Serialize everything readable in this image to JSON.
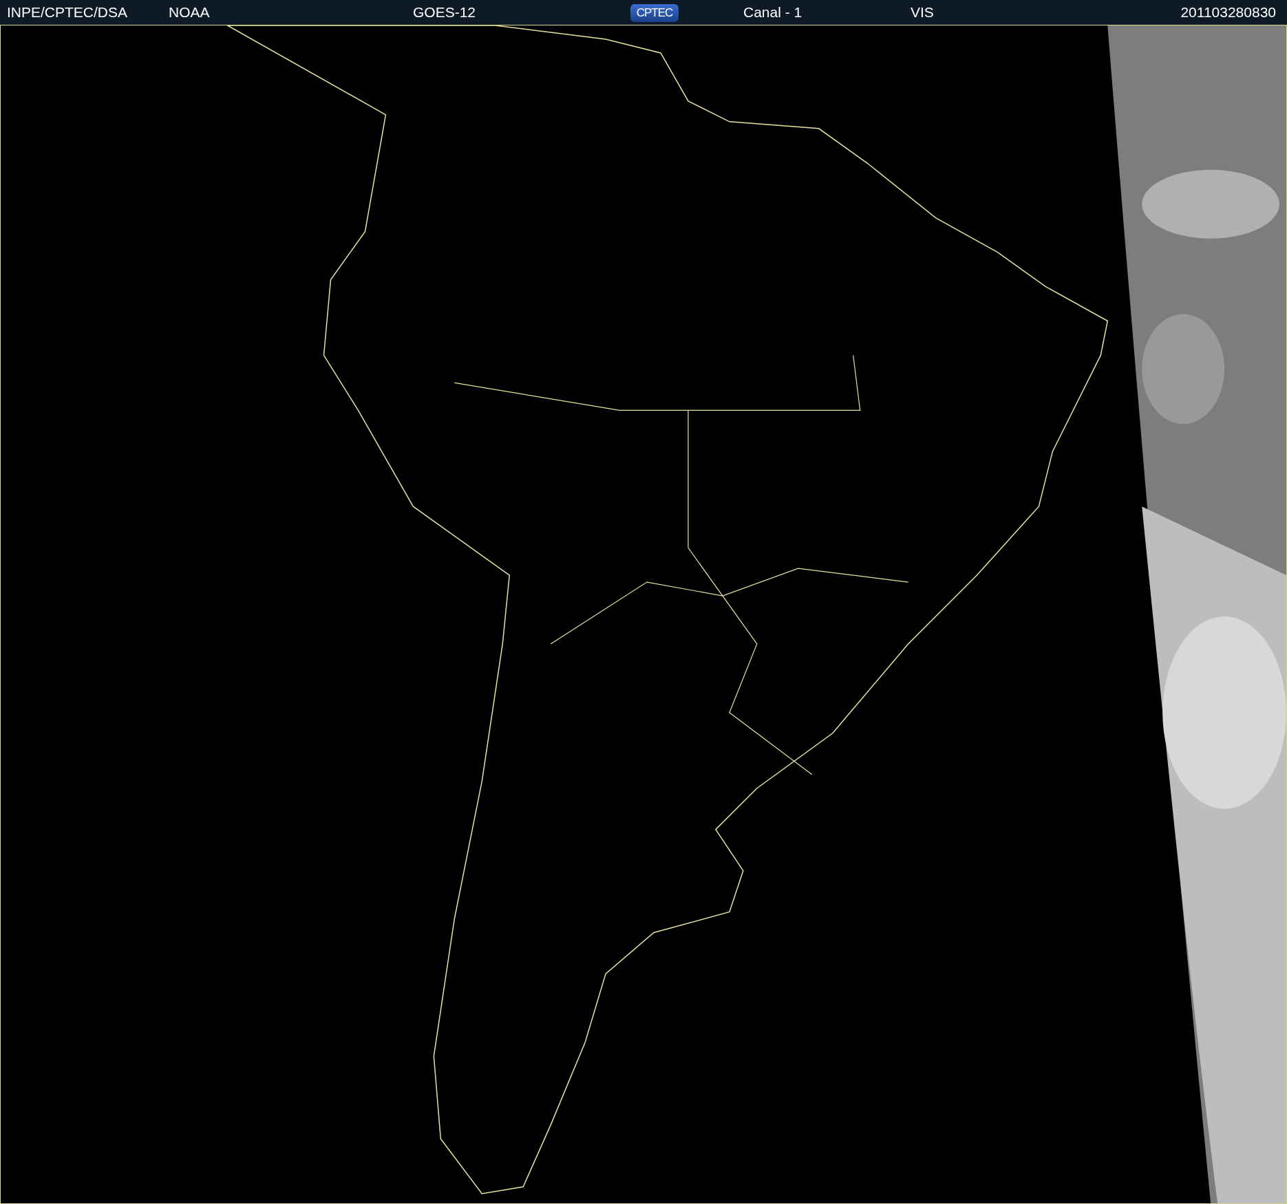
{
  "header": {
    "items": [
      {
        "kind": "text",
        "text": "INPE/CPTEC/DSA"
      },
      {
        "kind": "text",
        "text": "NOAA"
      },
      {
        "kind": "text",
        "text": "GOES-12"
      },
      {
        "kind": "logo",
        "text": "CPTEC"
      },
      {
        "kind": "text",
        "text": "Canal - 1"
      },
      {
        "kind": "text",
        "text": "VIS"
      },
      {
        "kind": "text",
        "text": "201103280830"
      }
    ]
  }
}
